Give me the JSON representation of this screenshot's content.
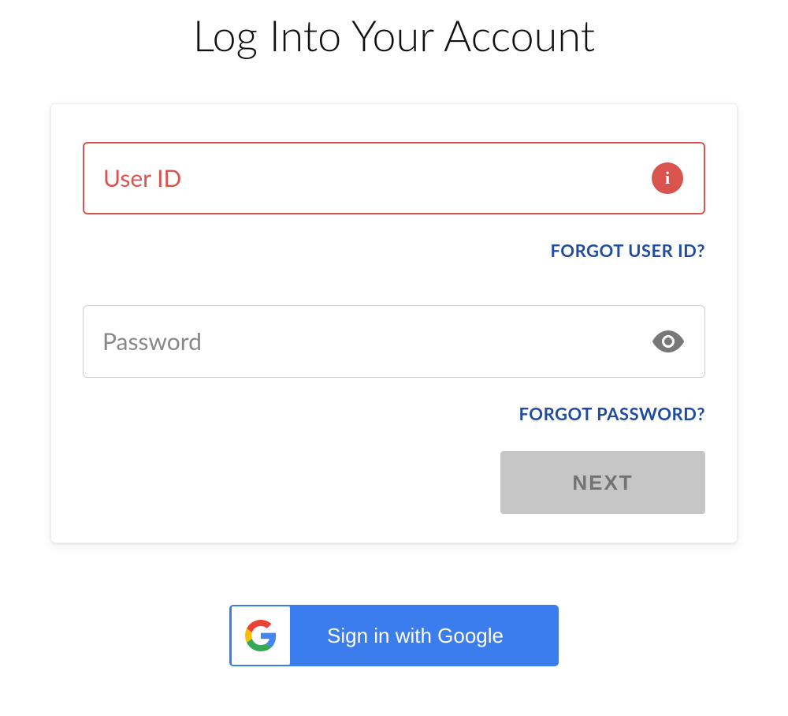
{
  "page_title": "Log Into Your Account",
  "user_id": {
    "placeholder": "User ID",
    "value": "",
    "error": true,
    "forgot_link": "FORGOT USER ID?"
  },
  "password": {
    "placeholder": "Password",
    "value": "",
    "forgot_link": "FORGOT PASSWORD?"
  },
  "next_label": "NEXT",
  "google_sso_label": "Sign in with Google",
  "colors": {
    "error": "#d9534f",
    "link": "#1f4c9e",
    "google_blue": "#3b7ded",
    "disabled_bg": "#c6c6c6",
    "disabled_text": "#737373"
  }
}
